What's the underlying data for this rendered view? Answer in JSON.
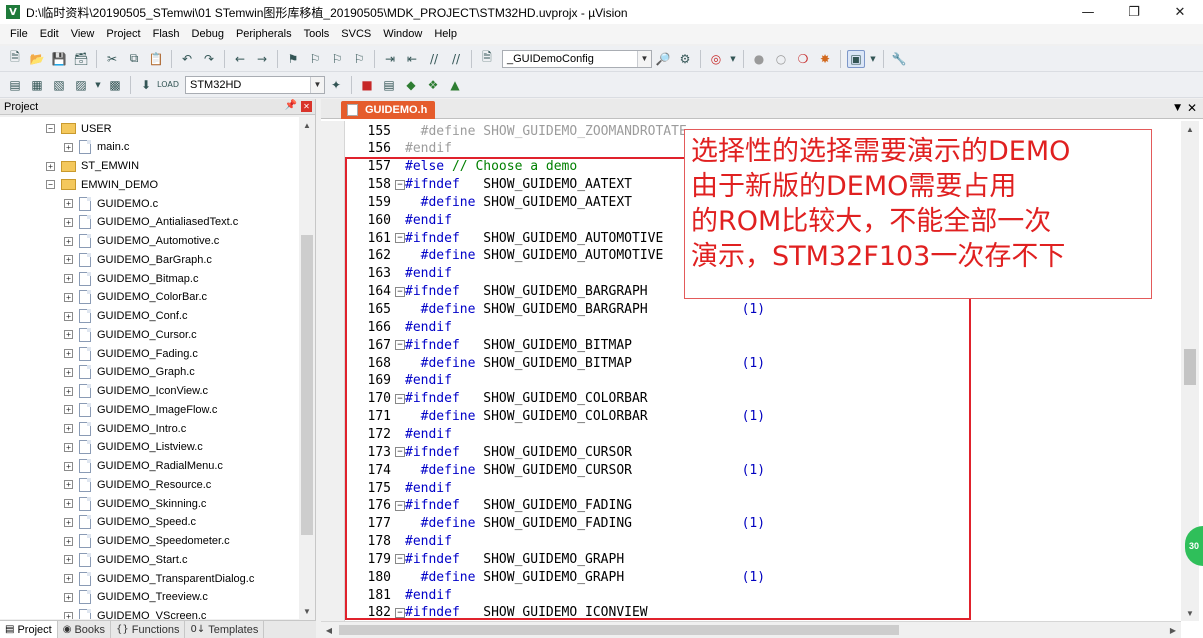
{
  "window": {
    "title": "D:\\临时资料\\20190505_STemwi\\01 STemwin图形库移植_20190505\\MDK_PROJECT\\STM32HD.uvprojx - µVision",
    "app_icon": "V",
    "buttons": [
      "minimize-icon",
      "maximize-icon",
      "close-icon"
    ]
  },
  "menubar": [
    "File",
    "Edit",
    "View",
    "Project",
    "Flash",
    "Debug",
    "Peripherals",
    "Tools",
    "SVCS",
    "Window",
    "Help"
  ],
  "toolbar1": {
    "target_combo": "_GUIDemoConfig"
  },
  "toolbar2": {
    "target_combo": "STM32HD"
  },
  "project_panel": {
    "title": "Project",
    "tree": [
      {
        "depth": 3,
        "kind": "folder",
        "expander": "−",
        "label": "USER"
      },
      {
        "depth": 4,
        "kind": "file",
        "expander": "+",
        "label": "main.c"
      },
      {
        "depth": 3,
        "kind": "folder",
        "expander": "+",
        "label": "ST_EMWIN"
      },
      {
        "depth": 3,
        "kind": "folder",
        "expander": "−",
        "label": "EMWIN_DEMO"
      },
      {
        "depth": 4,
        "kind": "file",
        "expander": "+",
        "label": "GUIDEMO.c"
      },
      {
        "depth": 4,
        "kind": "file",
        "expander": "+",
        "label": "GUIDEMO_AntialiasedText.c"
      },
      {
        "depth": 4,
        "kind": "file",
        "expander": "+",
        "label": "GUIDEMO_Automotive.c"
      },
      {
        "depth": 4,
        "kind": "file",
        "expander": "+",
        "label": "GUIDEMO_BarGraph.c"
      },
      {
        "depth": 4,
        "kind": "file",
        "expander": "+",
        "label": "GUIDEMO_Bitmap.c"
      },
      {
        "depth": 4,
        "kind": "file",
        "expander": "+",
        "label": "GUIDEMO_ColorBar.c"
      },
      {
        "depth": 4,
        "kind": "file",
        "expander": "+",
        "label": "GUIDEMO_Conf.c"
      },
      {
        "depth": 4,
        "kind": "file",
        "expander": "+",
        "label": "GUIDEMO_Cursor.c"
      },
      {
        "depth": 4,
        "kind": "file",
        "expander": "+",
        "label": "GUIDEMO_Fading.c"
      },
      {
        "depth": 4,
        "kind": "file",
        "expander": "+",
        "label": "GUIDEMO_Graph.c"
      },
      {
        "depth": 4,
        "kind": "file",
        "expander": "+",
        "label": "GUIDEMO_IconView.c"
      },
      {
        "depth": 4,
        "kind": "file",
        "expander": "+",
        "label": "GUIDEMO_ImageFlow.c"
      },
      {
        "depth": 4,
        "kind": "file",
        "expander": "+",
        "label": "GUIDEMO_Intro.c"
      },
      {
        "depth": 4,
        "kind": "file",
        "expander": "+",
        "label": "GUIDEMO_Listview.c"
      },
      {
        "depth": 4,
        "kind": "file",
        "expander": "+",
        "label": "GUIDEMO_RadialMenu.c"
      },
      {
        "depth": 4,
        "kind": "file",
        "expander": "+",
        "label": "GUIDEMO_Resource.c"
      },
      {
        "depth": 4,
        "kind": "file",
        "expander": "+",
        "label": "GUIDEMO_Skinning.c"
      },
      {
        "depth": 4,
        "kind": "file",
        "expander": "+",
        "label": "GUIDEMO_Speed.c"
      },
      {
        "depth": 4,
        "kind": "file",
        "expander": "+",
        "label": "GUIDEMO_Speedometer.c"
      },
      {
        "depth": 4,
        "kind": "file",
        "expander": "+",
        "label": "GUIDEMO_Start.c"
      },
      {
        "depth": 4,
        "kind": "file",
        "expander": "+",
        "label": "GUIDEMO_TransparentDialog.c"
      },
      {
        "depth": 4,
        "kind": "file",
        "expander": "+",
        "label": "GUIDEMO_Treeview.c"
      },
      {
        "depth": 4,
        "kind": "file",
        "expander": "+",
        "label": "GUIDEMO_VScreen.c"
      }
    ]
  },
  "bottom_tabs": [
    {
      "label": "Project",
      "icon": "project-icon",
      "active": true
    },
    {
      "label": "Books",
      "icon": "books-icon",
      "active": false
    },
    {
      "label": "Functions",
      "icon": "functions-icon",
      "active": false
    },
    {
      "label": "Templates",
      "icon": "templates-icon",
      "active": false
    }
  ],
  "editor": {
    "tab_label": "GUIDEMO.h",
    "lines": [
      {
        "no": "155",
        "fold": "",
        "pp": "  #define",
        "ident": " SHOW_GUIDEMO_ZOOMANDROTATE",
        "num": "",
        "dim": true
      },
      {
        "no": "156",
        "fold": "",
        "pp": "#endif",
        "ident": "",
        "num": "",
        "dim": true
      },
      {
        "no": "157",
        "fold": "",
        "pp": "#else",
        "ident": "",
        "comment": " // Choose a demo",
        "num": ""
      },
      {
        "no": "158",
        "fold": "−",
        "pp": "#ifndef",
        "ident": "   SHOW_GUIDEMO_AATEXT",
        "num": ""
      },
      {
        "no": "159",
        "fold": "",
        "pp": "  #define",
        "ident": " SHOW_GUIDEMO_AATEXT",
        "num": ""
      },
      {
        "no": "160",
        "fold": "",
        "pp": "#endif",
        "ident": "",
        "num": ""
      },
      {
        "no": "161",
        "fold": "−",
        "pp": "#ifndef",
        "ident": "   SHOW_GUIDEMO_AUTOMOTIVE",
        "num": ""
      },
      {
        "no": "162",
        "fold": "",
        "pp": "  #define",
        "ident": " SHOW_GUIDEMO_AUTOMOTIVE",
        "num": ""
      },
      {
        "no": "163",
        "fold": "",
        "pp": "#endif",
        "ident": "",
        "num": ""
      },
      {
        "no": "164",
        "fold": "−",
        "pp": "#ifndef",
        "ident": "   SHOW_GUIDEMO_BARGRAPH",
        "num": ""
      },
      {
        "no": "165",
        "fold": "",
        "pp": "  #define",
        "ident": " SHOW_GUIDEMO_BARGRAPH            ",
        "num": "(1)"
      },
      {
        "no": "166",
        "fold": "",
        "pp": "#endif",
        "ident": "",
        "num": ""
      },
      {
        "no": "167",
        "fold": "−",
        "pp": "#ifndef",
        "ident": "   SHOW_GUIDEMO_BITMAP",
        "num": ""
      },
      {
        "no": "168",
        "fold": "",
        "pp": "  #define",
        "ident": " SHOW_GUIDEMO_BITMAP              ",
        "num": "(1)"
      },
      {
        "no": "169",
        "fold": "",
        "pp": "#endif",
        "ident": "",
        "num": ""
      },
      {
        "no": "170",
        "fold": "−",
        "pp": "#ifndef",
        "ident": "   SHOW_GUIDEMO_COLORBAR",
        "num": ""
      },
      {
        "no": "171",
        "fold": "",
        "pp": "  #define",
        "ident": " SHOW_GUIDEMO_COLORBAR            ",
        "num": "(1)"
      },
      {
        "no": "172",
        "fold": "",
        "pp": "#endif",
        "ident": "",
        "num": ""
      },
      {
        "no": "173",
        "fold": "−",
        "pp": "#ifndef",
        "ident": "   SHOW_GUIDEMO_CURSOR",
        "num": ""
      },
      {
        "no": "174",
        "fold": "",
        "pp": "  #define",
        "ident": " SHOW_GUIDEMO_CURSOR              ",
        "num": "(1)"
      },
      {
        "no": "175",
        "fold": "",
        "pp": "#endif",
        "ident": "",
        "num": ""
      },
      {
        "no": "176",
        "fold": "−",
        "pp": "#ifndef",
        "ident": "   SHOW_GUIDEMO_FADING",
        "num": ""
      },
      {
        "no": "177",
        "fold": "",
        "pp": "  #define",
        "ident": " SHOW_GUIDEMO_FADING              ",
        "num": "(1)"
      },
      {
        "no": "178",
        "fold": "",
        "pp": "#endif",
        "ident": "",
        "num": ""
      },
      {
        "no": "179",
        "fold": "−",
        "pp": "#ifndef",
        "ident": "   SHOW_GUIDEMO_GRAPH",
        "num": ""
      },
      {
        "no": "180",
        "fold": "",
        "pp": "  #define",
        "ident": " SHOW_GUIDEMO_GRAPH               ",
        "num": "(1)"
      },
      {
        "no": "181",
        "fold": "",
        "pp": "#endif",
        "ident": "",
        "num": ""
      },
      {
        "no": "182",
        "fold": "−",
        "pp": "#ifndef",
        "ident": "   SHOW_GUIDEMO_ICONVIEW",
        "num": ""
      }
    ]
  },
  "annotation": {
    "lines": [
      "选择性的选择需要演示的DEMO",
      "由于新版的DEMO需要占用",
      "的ROM比较大，不能全部一次",
      "演示，STM32F103一次存不下"
    ],
    "color": "#e02020"
  },
  "badge": "30"
}
